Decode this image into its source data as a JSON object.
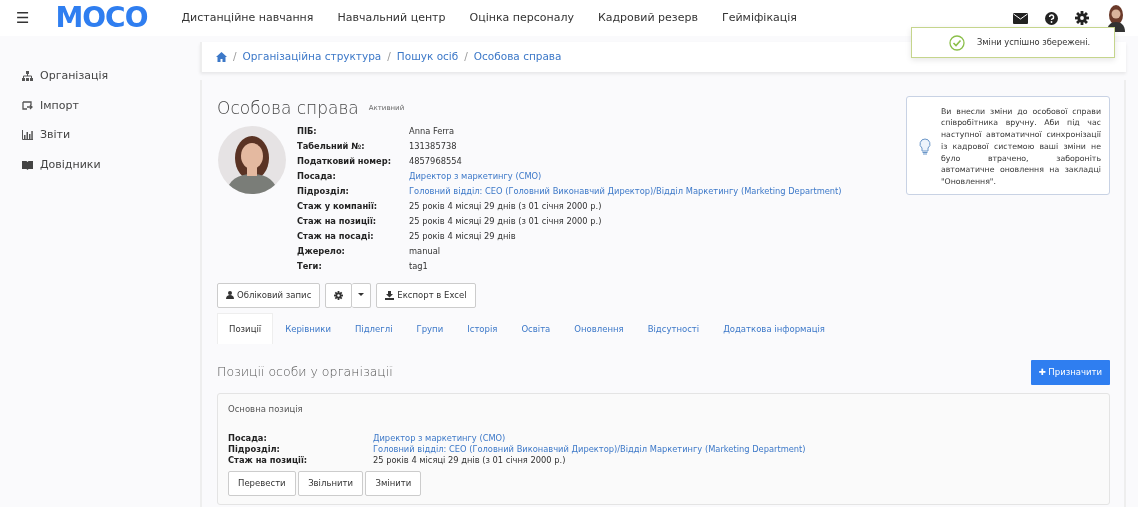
{
  "header": {
    "logo": "MOCO",
    "menu_icon": "☰",
    "nav": [
      "Дистанційне навчання",
      "Навчальний центр",
      "Оцінка персоналу",
      "Кадровий резерв",
      "Гейміфікація"
    ]
  },
  "sidebar": {
    "items": [
      {
        "label": "Організація"
      },
      {
        "label": "Імпорт"
      },
      {
        "label": "Звіти"
      },
      {
        "label": "Довідники"
      }
    ]
  },
  "breadcrumb": {
    "separator": "/",
    "items": [
      "Організаційна структура",
      "Пошук осіб",
      "Особова справа"
    ]
  },
  "toast": {
    "text": "Зміни успішно збережені."
  },
  "profile": {
    "title": "Особова справа",
    "status": "Активний",
    "fields": [
      {
        "label": "ПІБ:",
        "value": "Anna Ferra",
        "kind": "text"
      },
      {
        "label": "Табельний №:",
        "value": "131385738",
        "kind": "text"
      },
      {
        "label": "Податковий номер:",
        "value": "4857968554",
        "kind": "text"
      },
      {
        "label": "Посада:",
        "value": "Директор з маркетингу (CMO)",
        "kind": "link"
      },
      {
        "label": "Підрозділ:",
        "value": "Головний відділ: CEO (Головний Виконавчий Директор)/Відділ Маркетингу (Marketing Department)",
        "kind": "link"
      },
      {
        "label": "Стаж у компанії:",
        "value": "25 років 4 місяці 29 днів (з 01 січня 2000 р.)",
        "kind": "text"
      },
      {
        "label": "Стаж на позиції:",
        "value": "25 років 4 місяці 29 днів (з 01 січня 2000 р.)",
        "kind": "text"
      },
      {
        "label": "Стаж на посаді:",
        "value": "25 років 4 місяці 29 днів",
        "kind": "text"
      },
      {
        "label": "Джерело:",
        "value": "manual",
        "kind": "text"
      },
      {
        "label": "Теги:",
        "value": "tag1",
        "kind": "text"
      }
    ]
  },
  "notice": {
    "text": "Ви внесли зміни до особової справи співробітника вручну. Аби під час наступної автоматичної синхронізації із кадрової системою ваші зміни не було втрачено, забороніть автоматичне оновлення на закладці \"Оновлення\"."
  },
  "actions": {
    "account": "Обліковий запис",
    "export": "Експорт в Excel"
  },
  "tabs": [
    {
      "label": "Позиції",
      "selected": true
    },
    {
      "label": "Керівники",
      "selected": false
    },
    {
      "label": "Підлеглі",
      "selected": false
    },
    {
      "label": "Групи",
      "selected": false
    },
    {
      "label": "Історія",
      "selected": false
    },
    {
      "label": "Освіта",
      "selected": false
    },
    {
      "label": "Оновлення",
      "selected": false
    },
    {
      "label": "Відсутності",
      "selected": false
    },
    {
      "label": "Додаткова інформація",
      "selected": false
    }
  ],
  "positions": {
    "title": "Позиції особи у організації",
    "assign_icon": "✚",
    "assign_button": "Призначити",
    "card_title": "Основна позиція",
    "fields": [
      {
        "label": "Посада:",
        "value": "Директор з маркетингу (CMO)",
        "kind": "link"
      },
      {
        "label": "Підрозділ:",
        "value": "Головний відділ: CEO (Головний Виконавчий Директор)/Відділ Маркетингу (Marketing Department)",
        "kind": "link"
      },
      {
        "label": "Стаж на позиції:",
        "value": "25 років 4 місяці 29 днів (з 01 січня 2000 р.)",
        "kind": "text"
      }
    ],
    "buttons": [
      "Перевести",
      "Звільнити",
      "Змінити"
    ]
  }
}
